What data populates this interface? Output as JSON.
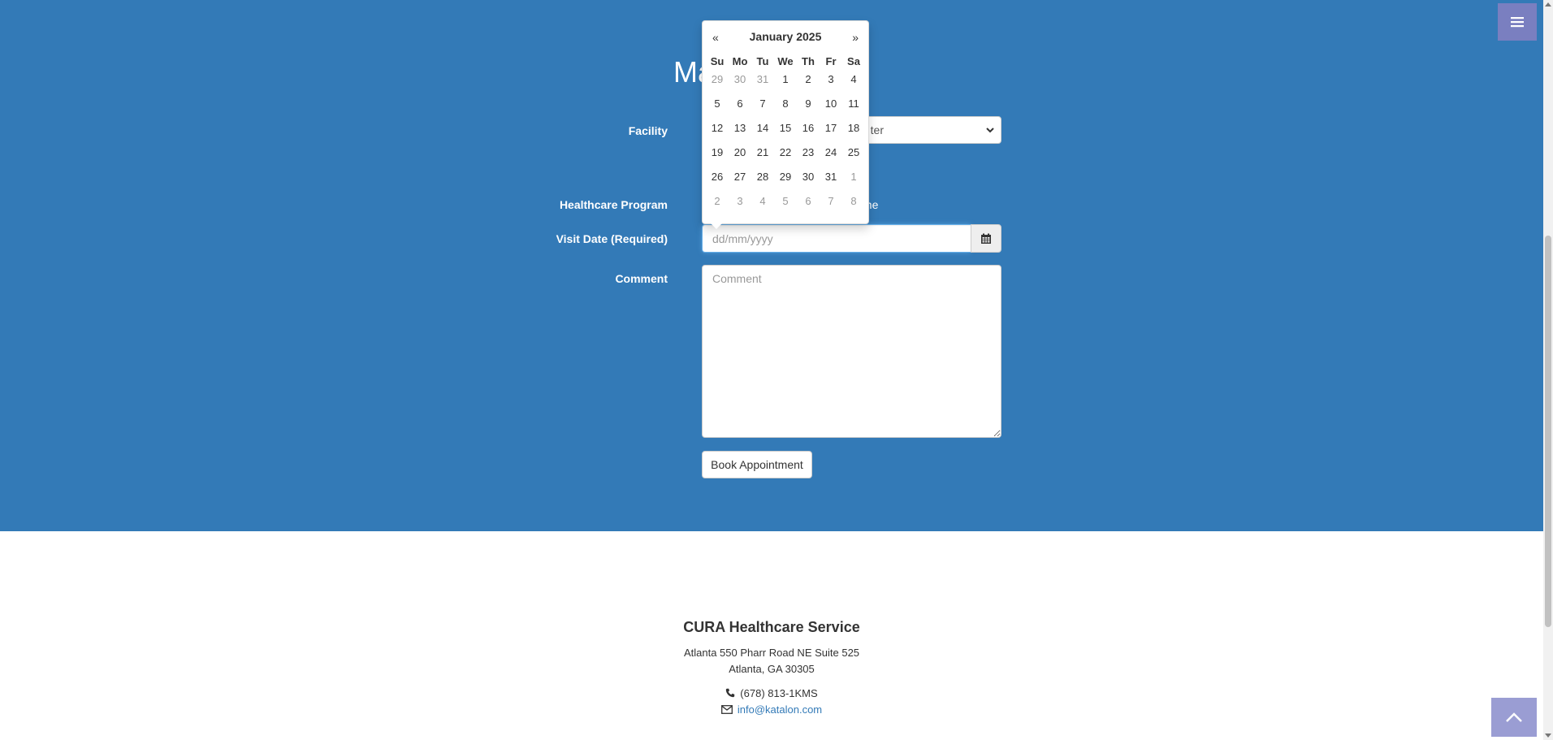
{
  "page": {
    "title": "Ma",
    "labels": {
      "facility": "Facility",
      "program": "Healthcare Program",
      "visit_date": "Visit Date (Required)",
      "comment": "Comment"
    },
    "facility_select": {
      "visible_text": "ter"
    },
    "program_radio_text": "one",
    "visit_date": {
      "value": "",
      "placeholder": "dd/mm/yyyy"
    },
    "comment": {
      "placeholder": "Comment"
    },
    "book_button": "Book Appointment"
  },
  "datepicker": {
    "prev": "«",
    "next": "»",
    "month_label": "January 2025",
    "weekdays": [
      "Su",
      "Mo",
      "Tu",
      "We",
      "Th",
      "Fr",
      "Sa"
    ],
    "weeks": [
      [
        {
          "d": "29",
          "muted": true
        },
        {
          "d": "30",
          "muted": true
        },
        {
          "d": "31",
          "muted": true
        },
        {
          "d": "1"
        },
        {
          "d": "2"
        },
        {
          "d": "3"
        },
        {
          "d": "4"
        }
      ],
      [
        {
          "d": "5"
        },
        {
          "d": "6"
        },
        {
          "d": "7"
        },
        {
          "d": "8"
        },
        {
          "d": "9"
        },
        {
          "d": "10"
        },
        {
          "d": "11"
        }
      ],
      [
        {
          "d": "12"
        },
        {
          "d": "13"
        },
        {
          "d": "14"
        },
        {
          "d": "15"
        },
        {
          "d": "16"
        },
        {
          "d": "17"
        },
        {
          "d": "18"
        }
      ],
      [
        {
          "d": "19"
        },
        {
          "d": "20"
        },
        {
          "d": "21"
        },
        {
          "d": "22"
        },
        {
          "d": "23"
        },
        {
          "d": "24"
        },
        {
          "d": "25"
        }
      ],
      [
        {
          "d": "26"
        },
        {
          "d": "27"
        },
        {
          "d": "28"
        },
        {
          "d": "29"
        },
        {
          "d": "30"
        },
        {
          "d": "31"
        },
        {
          "d": "1",
          "muted": true
        }
      ],
      [
        {
          "d": "2",
          "muted": true
        },
        {
          "d": "3",
          "muted": true
        },
        {
          "d": "4",
          "muted": true
        },
        {
          "d": "5",
          "muted": true
        },
        {
          "d": "6",
          "muted": true
        },
        {
          "d": "7",
          "muted": true
        },
        {
          "d": "8",
          "muted": true
        }
      ]
    ]
  },
  "footer": {
    "title": "CURA Healthcare Service",
    "address1": "Atlanta 550 Pharr Road NE Suite 525",
    "address2": "Atlanta, GA 30305",
    "phone": "(678) 813-1KMS",
    "email": "info@katalon.com"
  },
  "icons": {
    "menu": "hamburger-menu-icon",
    "calendar": "calendar-icon",
    "phone": "phone-icon",
    "email": "envelope-icon",
    "scroll_top": "chevron-up-icon",
    "select_caret": "chevron-down-icon"
  },
  "colors": {
    "hero": "#337ab7",
    "menu_button": "#7a7fc0",
    "link": "#337ab7"
  }
}
